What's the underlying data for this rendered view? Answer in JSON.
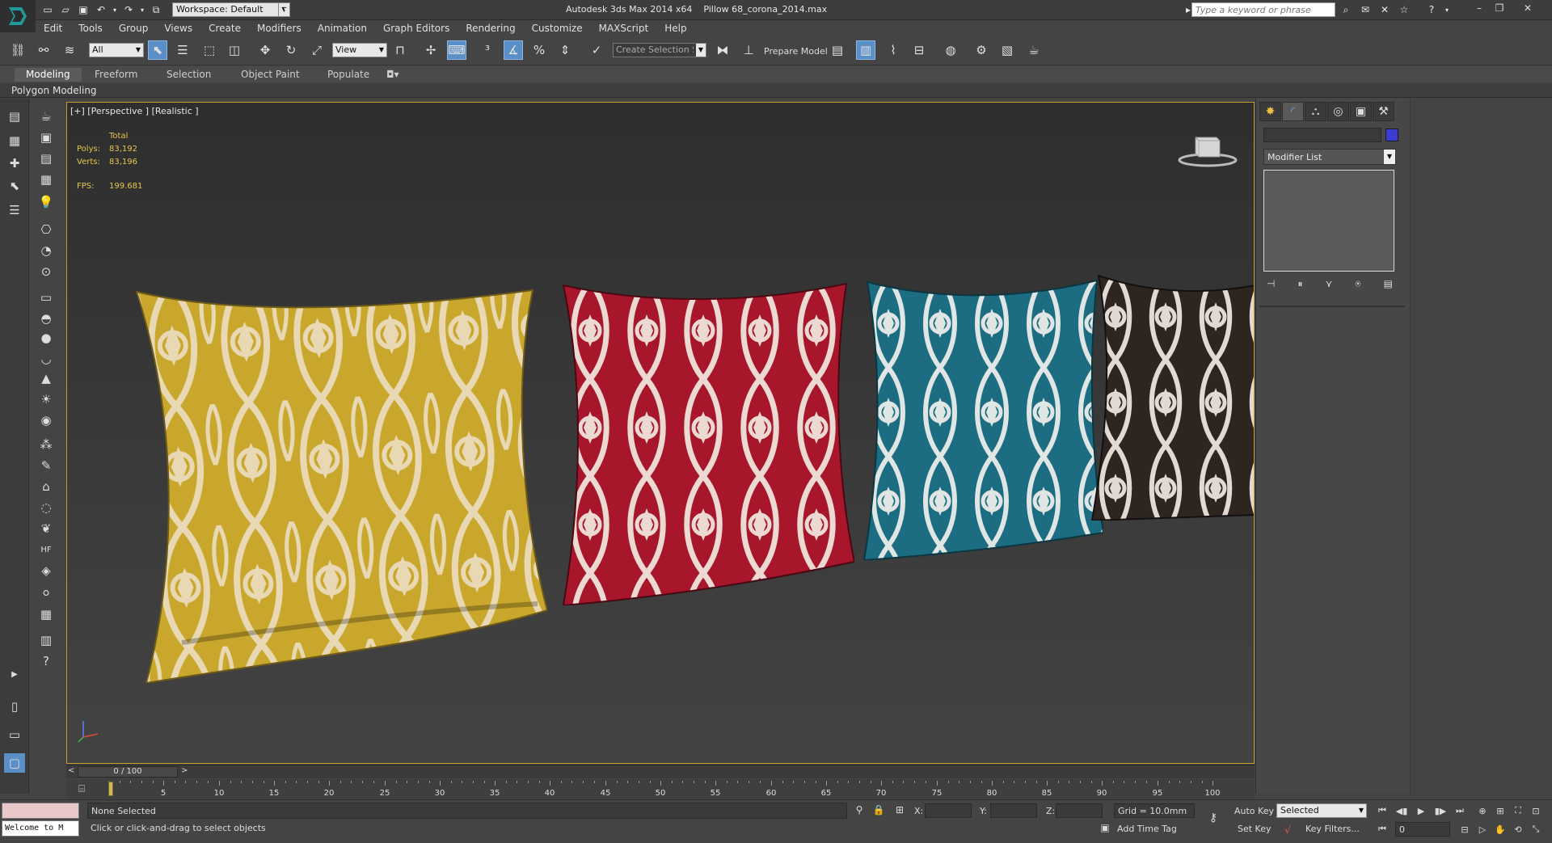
{
  "window": {
    "app_title": "Autodesk 3ds Max  2014 x64",
    "file_name": "Pillow 68_corona_2014.max"
  },
  "titlebar": {
    "workspace_label": "Workspace: Default",
    "search_placeholder": "Type a keyword or phrase"
  },
  "menu": [
    "Edit",
    "Tools",
    "Group",
    "Views",
    "Create",
    "Modifiers",
    "Animation",
    "Graph Editors",
    "Rendering",
    "Customize",
    "MAXScript",
    "Help"
  ],
  "toolbar": {
    "filter_value": "All",
    "ref_coord_value": "View",
    "create_selection_set": "Create Selection Se",
    "prepare_model": "Prepare Model"
  },
  "ribbon": {
    "tabs": [
      "Modeling",
      "Freeform",
      "Selection",
      "Object Paint",
      "Populate"
    ],
    "active_tab": "Modeling",
    "panel_label": "Polygon Modeling"
  },
  "viewport": {
    "label": "[+] [Perspective ] [Realistic ]",
    "stats_header": "Total",
    "polys_label": "Polys:",
    "polys_value": "83,192",
    "verts_label": "Verts:",
    "verts_value": "83,196",
    "fps_label": "FPS:",
    "fps_value": "199.681",
    "pillows": [
      {
        "name": "yellow-pillow",
        "color": "#c9a62c"
      },
      {
        "name": "red-pillow",
        "color": "#a8162c"
      },
      {
        "name": "teal-pillow",
        "color": "#1c6d82"
      },
      {
        "name": "brown-pillow",
        "color": "#2e2521"
      }
    ]
  },
  "command_panel": {
    "modifier_list_label": "Modifier List",
    "object_color": "#3b3bd6"
  },
  "timeslider": {
    "frame_display": "0 / 100",
    "prev": "<",
    "next": ">"
  },
  "trackbar": {
    "ticks": [
      "0",
      "5",
      "10",
      "15",
      "20",
      "25",
      "30",
      "35",
      "40",
      "45",
      "50",
      "55",
      "60",
      "65",
      "70",
      "75",
      "80",
      "85",
      "90",
      "95",
      "100"
    ]
  },
  "status": {
    "listener_text": "Welcome to M",
    "selection": "None Selected",
    "prompt": "Click or click-and-drag to select objects",
    "x_label": "X:",
    "y_label": "Y:",
    "z_label": "Z:",
    "grid": "Grid = 10.0mm",
    "add_time_tag": "Add Time Tag",
    "auto_key": "Auto Key",
    "set_key": "Set Key",
    "selected_dd": "Selected",
    "key_filters": "Key Filters...",
    "current_frame": "0"
  }
}
